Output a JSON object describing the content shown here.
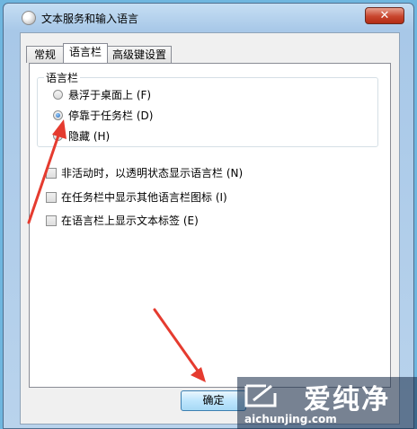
{
  "window": {
    "title": "文本服务和输入语言",
    "close_glyph": "✕"
  },
  "tabs": [
    {
      "label": "常规",
      "active": false
    },
    {
      "label": "语言栏",
      "active": true
    },
    {
      "label": "高级键设置",
      "active": false
    }
  ],
  "language_bar_group": {
    "title": "语言栏",
    "options": [
      {
        "label": "悬浮于桌面上 (F)",
        "selected": false
      },
      {
        "label": "停靠于任务栏 (D)",
        "selected": true
      },
      {
        "label": "隐藏 (H)",
        "selected": false
      }
    ]
  },
  "checkboxes": [
    {
      "label": "非活动时，以透明状态显示语言栏 (N)",
      "checked": false
    },
    {
      "label": "在任务栏中显示其他语言栏图标 (I)",
      "checked": false
    },
    {
      "label": "在语言栏上显示文本标签 (E)",
      "checked": false
    }
  ],
  "buttons": {
    "ok": "确定"
  },
  "watermark": {
    "text": "爱纯净",
    "url": "aichunjing.com"
  },
  "annotation_color": "#e53b2f"
}
